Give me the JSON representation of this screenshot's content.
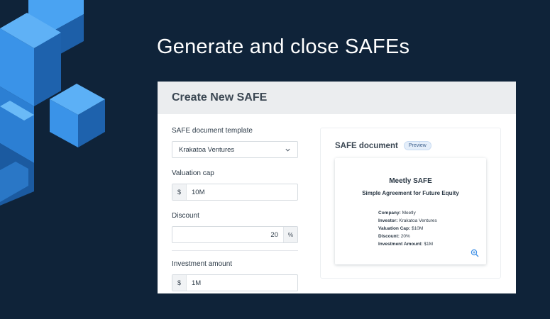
{
  "headline": "Generate and close SAFEs",
  "card": {
    "title": "Create New SAFE",
    "form": {
      "template_label": "SAFE document template",
      "template_value": "Krakatoa Ventures",
      "valuation_label": "Valuation cap",
      "valuation_prefix": "$",
      "valuation_value": "10M",
      "discount_label": "Discount",
      "discount_value": "20",
      "discount_suffix": "%",
      "investment_label": "Investment amount",
      "investment_prefix": "$",
      "investment_value": "1M"
    },
    "document": {
      "title": "SAFE document",
      "badge": "Preview",
      "doc_title": "Meetly SAFE",
      "doc_subtitle": "Simple Agreement for Future Equity",
      "fields": [
        {
          "key": "Company:",
          "value": "Meetly"
        },
        {
          "key": "Investor:",
          "value": "Krakatoa Ventures"
        },
        {
          "key": "Valuation Cap:",
          "value": "$10M"
        },
        {
          "key": "Discount:",
          "value": "20%"
        },
        {
          "key": "Investment Amount:",
          "value": "$1M"
        }
      ]
    }
  },
  "colors": {
    "background": "#0f2339",
    "accent": "#3d8fe6",
    "header_bg": "#ebedef"
  },
  "icons": [
    "chevron-down-icon",
    "zoom-in-icon",
    "cube-decoration"
  ]
}
